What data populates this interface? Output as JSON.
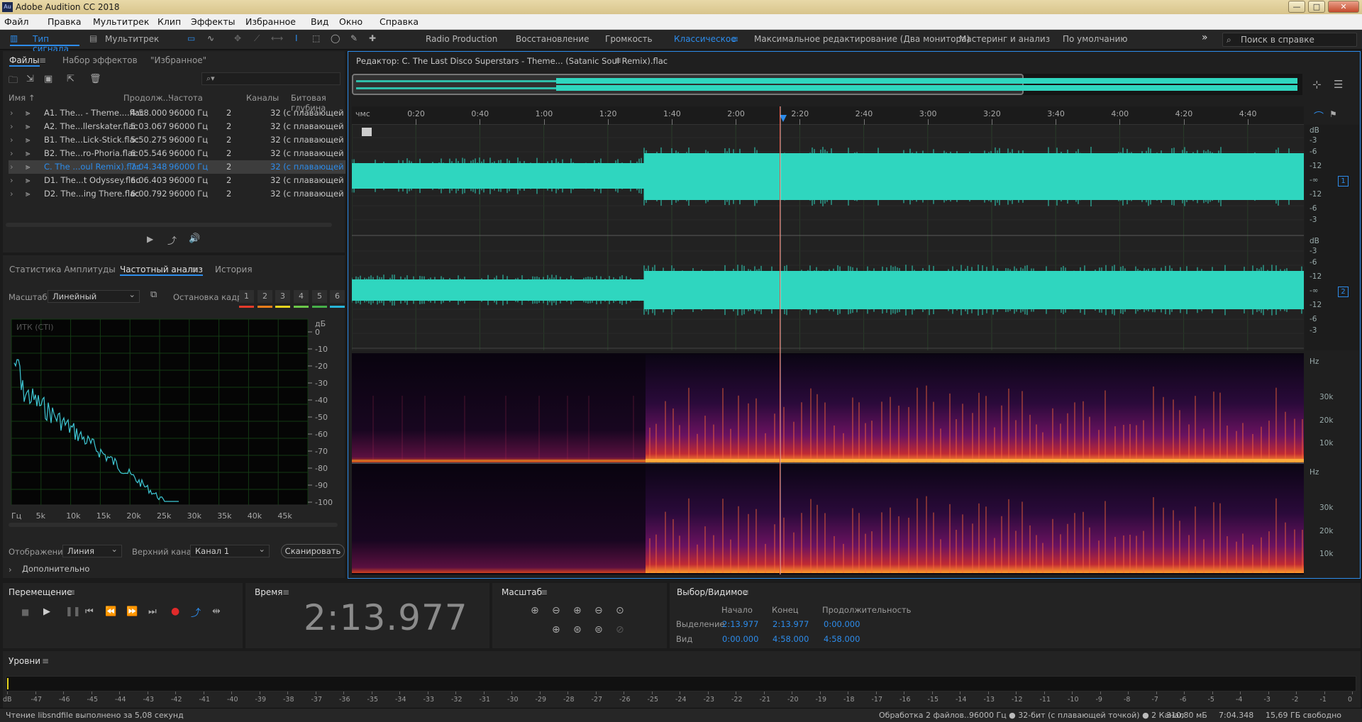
{
  "app": {
    "title": "Adobe Audition CC 2018",
    "logo_text": "Au"
  },
  "window_controls": [
    "—",
    "□",
    "✕"
  ],
  "menu": [
    "Файл",
    "Правка",
    "Мультитрек",
    "Клип",
    "Эффекты",
    "Избранное",
    "Вид",
    "Окно",
    "Справка"
  ],
  "toolbar": {
    "mode_waveform": "Тип сигнала",
    "mode_multitrack": "Мультитрек",
    "workspaces": [
      "Radio Production",
      "Восстановление",
      "Громкость",
      "Классическое",
      "Максимальное редактирование (Два монитора)",
      "Мастеринг и анализ",
      "По умолчанию"
    ],
    "active_workspace": "Классическое",
    "more": "»",
    "search_placeholder": "Поиск в справке"
  },
  "files_panel": {
    "tabs": [
      "Файлы",
      "Набор эффектов",
      "\"Избранное\""
    ],
    "search_icon": "⌕▾",
    "columns": [
      "Имя ↑",
      "Продолж...",
      "Частота",
      "Каналы",
      "Битовая глубина"
    ],
    "rows": [
      {
        "name": "A1. The... - Theme....flac",
        "duration": "4:58.000",
        "rate": "96000 Гц",
        "channels": "2",
        "bits": "32 (с плавающей точ"
      },
      {
        "name": "A2. The...llerskater.flac",
        "duration": "5:03.067",
        "rate": "96000 Гц",
        "channels": "2",
        "bits": "32 (с плавающей точ"
      },
      {
        "name": "B1. The...Lick-Stick.flac",
        "duration": "5:50.275",
        "rate": "96000 Гц",
        "channels": "2",
        "bits": "32 (с плавающей точ"
      },
      {
        "name": "B2. The...ro-Phoria.flac",
        "duration": "6:05.546",
        "rate": "96000 Гц",
        "channels": "2",
        "bits": "32 (с плавающей точ"
      },
      {
        "name": "C. The ...oul Remix).flac",
        "duration": "7:04.348",
        "rate": "96000 Гц",
        "channels": "2",
        "bits": "32 (с плавающей точ",
        "selected": true
      },
      {
        "name": "D1. The...t Odyssey.flac",
        "duration": "6:06.403",
        "rate": "96000 Гц",
        "channels": "2",
        "bits": "32 (с плавающей точ"
      },
      {
        "name": "D2. The...ing There.flac",
        "duration": "6:00.792",
        "rate": "96000 Гц",
        "channels": "2",
        "bits": "32 (с плавающей точ"
      }
    ]
  },
  "analysis_panel": {
    "tabs": [
      "Статистика Амплитуды",
      "Частотный анализ",
      "История"
    ],
    "scale_label": "Масштаб:",
    "scale_value": "Линейный",
    "freeze_label": "Остановка кадра:",
    "freeze_slots": [
      "1",
      "2",
      "3",
      "4",
      "5",
      "6"
    ],
    "freeze_colors": [
      "#e53b2b",
      "#f07d1a",
      "#e6d41e",
      "#6cc84a",
      "#46b04a",
      "#27b5d8"
    ],
    "graph_label": "ИТК (СТI)",
    "db_ticks": [
      "дБ",
      "0",
      "-10",
      "-20",
      "-30",
      "-40",
      "-50",
      "-60",
      "-70",
      "-80",
      "-90",
      "-100"
    ],
    "hz_ticks": [
      "Гц",
      "5k",
      "10k",
      "15k",
      "20k",
      "25k",
      "30k",
      "35k",
      "40k",
      "45k"
    ],
    "display_label": "Отображение:",
    "display_value": "Линия",
    "channel_label": "Верхний канал:",
    "channel_value": "Канал 1",
    "scan_button": "Сканировать",
    "advanced": "Дополнительно"
  },
  "editor": {
    "title": "Редактор: C. The Last Disco Superstars - Theme... (Satanic Soul Remix).flac",
    "ruler_unit": "чмс",
    "ruler_ticks": [
      "0:20",
      "0:40",
      "1:00",
      "1:20",
      "1:40",
      "2:00",
      "2:20",
      "2:40",
      "3:00",
      "3:20",
      "3:40",
      "4:00",
      "4:20",
      "4:40"
    ],
    "db_scale": [
      "dB",
      "-3",
      "-6",
      "-12",
      "-∞",
      "-12",
      "-6",
      "-3"
    ],
    "channel_badges": [
      "1",
      "2"
    ],
    "spec_scale": [
      "Hz",
      "30k",
      "20k",
      "10k"
    ]
  },
  "transport": {
    "title": "Перемещение"
  },
  "time_panel": {
    "title": "Время",
    "time": "2:13.977"
  },
  "zoom_panel": {
    "title": "Масштаб"
  },
  "selection_panel": {
    "title": "Выбор/Видимое",
    "headers": [
      "Начало",
      "Конец",
      "Продолжительность"
    ],
    "sel_label": "Выделение",
    "sel_values": [
      "2:13.977",
      "2:13.977",
      "0:00.000"
    ],
    "view_label": "Вид",
    "view_values": [
      "0:00.000",
      "4:58.000",
      "4:58.000"
    ]
  },
  "levels": {
    "title": "Уровни",
    "scale": [
      "dB",
      "-47",
      "-46",
      "-45",
      "-44",
      "-43",
      "-42",
      "-41",
      "-40",
      "-39",
      "-38",
      "-37",
      "-36",
      "-35",
      "-34",
      "-33",
      "-32",
      "-31",
      "-30",
      "-29",
      "-28",
      "-27",
      "-26",
      "-25",
      "-24",
      "-23",
      "-22",
      "-21",
      "-20",
      "-19",
      "-18",
      "-17",
      "-16",
      "-15",
      "-14",
      "-13",
      "-12",
      "-11",
      "-10",
      "-9",
      "-8",
      "-7",
      "-6",
      "-5",
      "-4",
      "-3",
      "-2",
      "-1",
      "0"
    ]
  },
  "status": {
    "left": "Чтение libsndfile выполнено за 5,08 секунд",
    "items": [
      "Обработка 2 файлов...",
      "96000 Гц ● 32-бит (с плавающей точкой) ● 2 Канал",
      "310,80 мБ",
      "7:04.348",
      "15,69 ГБ свободно"
    ]
  },
  "colors": {
    "accent": "#2d8ceb",
    "waveform": "#2fd6bf",
    "playhead": "#e05a4a"
  }
}
